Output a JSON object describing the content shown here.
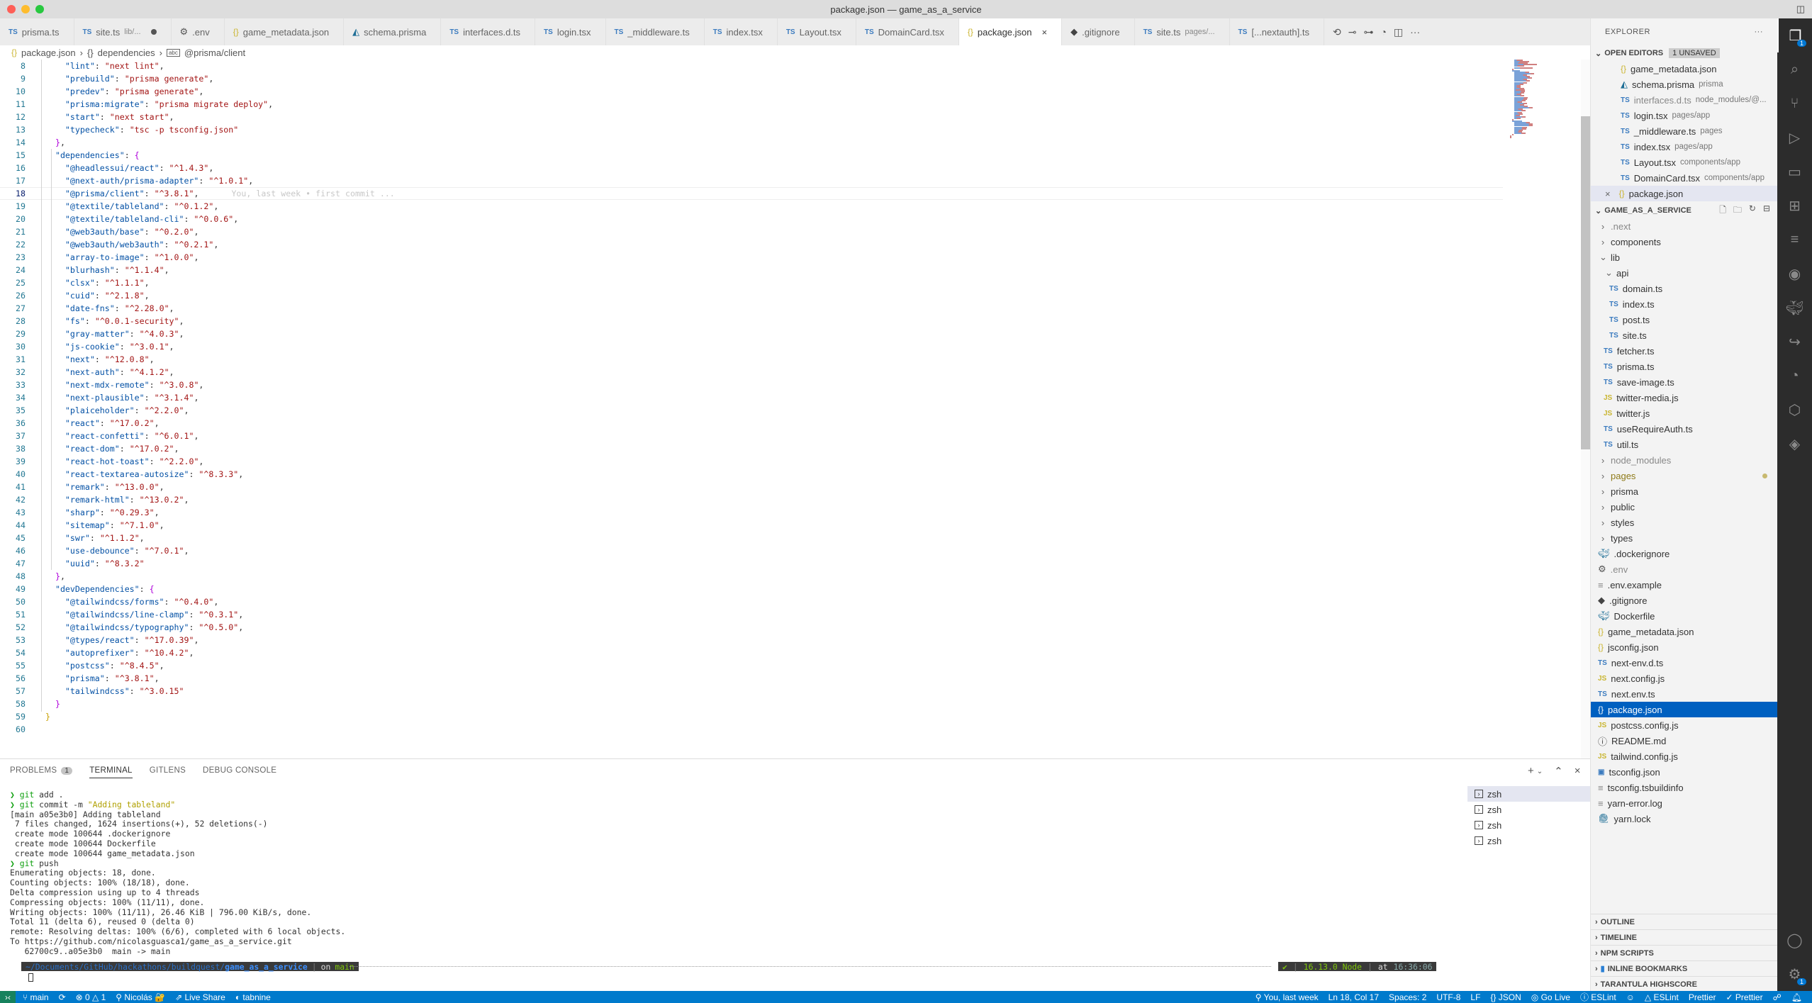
{
  "window": {
    "title": "package.json — game_as_a_service"
  },
  "tabs": [
    {
      "icon": "ts",
      "label": "prisma.ts",
      "desc": ""
    },
    {
      "icon": "ts",
      "label": "site.ts",
      "desc": "lib/...",
      "dirty": true
    },
    {
      "icon": "gear",
      "label": ".env",
      "desc": ""
    },
    {
      "icon": "json",
      "label": "game_metadata.json",
      "desc": ""
    },
    {
      "icon": "prisma",
      "label": "schema.prisma",
      "desc": ""
    },
    {
      "icon": "ts",
      "label": "interfaces.d.ts",
      "desc": ""
    },
    {
      "icon": "ts",
      "label": "login.tsx",
      "desc": ""
    },
    {
      "icon": "ts",
      "label": "_middleware.ts",
      "desc": ""
    },
    {
      "icon": "ts",
      "label": "index.tsx",
      "desc": ""
    },
    {
      "icon": "ts",
      "label": "Layout.tsx",
      "desc": ""
    },
    {
      "icon": "ts",
      "label": "DomainCard.tsx",
      "desc": ""
    },
    {
      "icon": "json",
      "label": "package.json",
      "desc": "",
      "active": true
    },
    {
      "icon": "git",
      "label": ".gitignore",
      "desc": ""
    },
    {
      "icon": "ts",
      "label": "site.ts",
      "desc": "pages/..."
    },
    {
      "icon": "ts",
      "label": "[...nextauth].ts",
      "desc": ""
    }
  ],
  "tab_actions": [
    "git-compare-icon",
    "previous-change-icon",
    "next-change-icon",
    "gitlens-icon",
    "split-editor-icon",
    "more-icon"
  ],
  "breadcrumb": [
    "package.json",
    "dependencies",
    "@prisma/client"
  ],
  "editor": {
    "blame": "You, last week • first commit ...",
    "current_line": 18,
    "lines": [
      {
        "n": 8,
        "indent": 2,
        "key": "lint",
        "val": "next lint",
        "comma": true
      },
      {
        "n": 9,
        "indent": 2,
        "key": "prebuild",
        "val": "prisma generate",
        "comma": true
      },
      {
        "n": 10,
        "indent": 2,
        "key": "predev",
        "val": "prisma generate",
        "comma": true
      },
      {
        "n": 11,
        "indent": 2,
        "key": "prisma:migrate",
        "val": "prisma migrate deploy",
        "comma": true
      },
      {
        "n": 12,
        "indent": 2,
        "key": "start",
        "val": "next start",
        "comma": true
      },
      {
        "n": 13,
        "indent": 2,
        "key": "typecheck",
        "val": "tsc -p tsconfig.json",
        "comma": false
      },
      {
        "n": 14,
        "indent": 1,
        "close": "}",
        "comma": true
      },
      {
        "n": 15,
        "indent": 1,
        "key": "dependencies",
        "open": "{"
      },
      {
        "n": 16,
        "indent": 2,
        "key": "@headlessui/react",
        "val": "^1.4.3",
        "comma": true
      },
      {
        "n": 17,
        "indent": 2,
        "key": "@next-auth/prisma-adapter",
        "val": "^1.0.1",
        "comma": true
      },
      {
        "n": 18,
        "indent": 2,
        "key": "@prisma/client",
        "val": "^3.8.1",
        "comma": true
      },
      {
        "n": 19,
        "indent": 2,
        "key": "@textile/tableland",
        "val": "^0.1.2",
        "comma": true
      },
      {
        "n": 20,
        "indent": 2,
        "key": "@textile/tableland-cli",
        "val": "^0.0.6",
        "comma": true
      },
      {
        "n": 21,
        "indent": 2,
        "key": "@web3auth/base",
        "val": "^0.2.0",
        "comma": true
      },
      {
        "n": 22,
        "indent": 2,
        "key": "@web3auth/web3auth",
        "val": "^0.2.1",
        "comma": true
      },
      {
        "n": 23,
        "indent": 2,
        "key": "array-to-image",
        "val": "^1.0.0",
        "comma": true
      },
      {
        "n": 24,
        "indent": 2,
        "key": "blurhash",
        "val": "^1.1.4",
        "comma": true
      },
      {
        "n": 25,
        "indent": 2,
        "key": "clsx",
        "val": "^1.1.1",
        "comma": true
      },
      {
        "n": 26,
        "indent": 2,
        "key": "cuid",
        "val": "^2.1.8",
        "comma": true
      },
      {
        "n": 27,
        "indent": 2,
        "key": "date-fns",
        "val": "^2.28.0",
        "comma": true
      },
      {
        "n": 28,
        "indent": 2,
        "key": "fs",
        "val": "^0.0.1-security",
        "comma": true
      },
      {
        "n": 29,
        "indent": 2,
        "key": "gray-matter",
        "val": "^4.0.3",
        "comma": true
      },
      {
        "n": 30,
        "indent": 2,
        "key": "js-cookie",
        "val": "^3.0.1",
        "comma": true
      },
      {
        "n": 31,
        "indent": 2,
        "key": "next",
        "val": "^12.0.8",
        "comma": true
      },
      {
        "n": 32,
        "indent": 2,
        "key": "next-auth",
        "val": "^4.1.2",
        "comma": true
      },
      {
        "n": 33,
        "indent": 2,
        "key": "next-mdx-remote",
        "val": "^3.0.8",
        "comma": true
      },
      {
        "n": 34,
        "indent": 2,
        "key": "next-plausible",
        "val": "^3.1.4",
        "comma": true
      },
      {
        "n": 35,
        "indent": 2,
        "key": "plaiceholder",
        "val": "^2.2.0",
        "comma": true
      },
      {
        "n": 36,
        "indent": 2,
        "key": "react",
        "val": "^17.0.2",
        "comma": true
      },
      {
        "n": 37,
        "indent": 2,
        "key": "react-confetti",
        "val": "^6.0.1",
        "comma": true
      },
      {
        "n": 38,
        "indent": 2,
        "key": "react-dom",
        "val": "^17.0.2",
        "comma": true
      },
      {
        "n": 39,
        "indent": 2,
        "key": "react-hot-toast",
        "val": "^2.2.0",
        "comma": true
      },
      {
        "n": 40,
        "indent": 2,
        "key": "react-textarea-autosize",
        "val": "^8.3.3",
        "comma": true
      },
      {
        "n": 41,
        "indent": 2,
        "key": "remark",
        "val": "^13.0.0",
        "comma": true
      },
      {
        "n": 42,
        "indent": 2,
        "key": "remark-html",
        "val": "^13.0.2",
        "comma": true
      },
      {
        "n": 43,
        "indent": 2,
        "key": "sharp",
        "val": "^0.29.3",
        "comma": true
      },
      {
        "n": 44,
        "indent": 2,
        "key": "sitemap",
        "val": "^7.1.0",
        "comma": true
      },
      {
        "n": 45,
        "indent": 2,
        "key": "swr",
        "val": "^1.1.2",
        "comma": true
      },
      {
        "n": 46,
        "indent": 2,
        "key": "use-debounce",
        "val": "^7.0.1",
        "comma": true
      },
      {
        "n": 47,
        "indent": 2,
        "key": "uuid",
        "val": "^8.3.2",
        "comma": false
      },
      {
        "n": 48,
        "indent": 1,
        "close": "}",
        "comma": true
      },
      {
        "n": 49,
        "indent": 1,
        "key": "devDependencies",
        "open": "{"
      },
      {
        "n": 50,
        "indent": 2,
        "key": "@tailwindcss/forms",
        "val": "^0.4.0",
        "comma": true
      },
      {
        "n": 51,
        "indent": 2,
        "key": "@tailwindcss/line-clamp",
        "val": "^0.3.1",
        "comma": true
      },
      {
        "n": 52,
        "indent": 2,
        "key": "@tailwindcss/typography",
        "val": "^0.5.0",
        "comma": true
      },
      {
        "n": 53,
        "indent": 2,
        "key": "@types/react",
        "val": "^17.0.39",
        "comma": true
      },
      {
        "n": 54,
        "indent": 2,
        "key": "autoprefixer",
        "val": "^10.4.2",
        "comma": true
      },
      {
        "n": 55,
        "indent": 2,
        "key": "postcss",
        "val": "^8.4.5",
        "comma": true
      },
      {
        "n": 56,
        "indent": 2,
        "key": "prisma",
        "val": "^3.8.1",
        "comma": true
      },
      {
        "n": 57,
        "indent": 2,
        "key": "tailwindcss",
        "val": "^3.0.15",
        "comma": false
      },
      {
        "n": 58,
        "indent": 1,
        "close": "}",
        "comma": false
      },
      {
        "n": 59,
        "indent": 0,
        "close": "}",
        "comma": false,
        "root": true
      },
      {
        "n": 60,
        "indent": 0,
        "empty": true
      }
    ]
  },
  "panel": {
    "tabs": [
      {
        "label": "PROBLEMS",
        "badge": "1"
      },
      {
        "label": "TERMINAL",
        "active": true
      },
      {
        "label": "GITLENS"
      },
      {
        "label": "DEBUG CONSOLE"
      }
    ],
    "terminal_lines": [
      {
        "type": "cmd",
        "cmd": "git",
        "rest": " add ."
      },
      {
        "type": "cmd",
        "cmd": "git",
        "rest": " commit -m ",
        "str": "\"Adding tableland\""
      },
      {
        "type": "out",
        "text": "[main a05e3b0] Adding tableland"
      },
      {
        "type": "out",
        "text": " 7 files changed, 1624 insertions(+), 52 deletions(-)"
      },
      {
        "type": "out",
        "text": " create mode 100644 .dockerignore"
      },
      {
        "type": "out",
        "text": " create mode 100644 Dockerfile"
      },
      {
        "type": "out",
        "text": " create mode 100644 game_metadata.json"
      },
      {
        "type": "cmd",
        "cmd": "git",
        "rest": " push"
      },
      {
        "type": "out",
        "text": "Enumerating objects: 18, done."
      },
      {
        "type": "out",
        "text": "Counting objects: 100% (18/18), done."
      },
      {
        "type": "out",
        "text": "Delta compression using up to 4 threads"
      },
      {
        "type": "out",
        "text": "Compressing objects: 100% (11/11), done."
      },
      {
        "type": "out",
        "text": "Writing objects: 100% (11/11), 26.46 KiB | 796.00 KiB/s, done."
      },
      {
        "type": "out",
        "text": "Total 11 (delta 6), reused 0 (delta 0)"
      },
      {
        "type": "out",
        "text": "remote: Resolving deltas: 100% (6/6), completed with 6 local objects."
      },
      {
        "type": "out",
        "text": "To https://github.com/nicolasguasca1/game_as_a_service.git"
      },
      {
        "type": "out",
        "text": "   62700c9..a05e3b0  main -> main"
      }
    ],
    "prompt": {
      "path_prefix": "~/Documents/GitHub/hackathons/buildquest/",
      "path_dir": "game_as_a_service",
      "on": "on",
      "branch": "main",
      "check": "✔",
      "node": "16.13.0 Node",
      "at": "at",
      "time": "16:36:06"
    },
    "terminals": [
      "zsh",
      "zsh",
      "zsh",
      "zsh"
    ]
  },
  "explorer": {
    "title": "EXPLORER",
    "open_editors_label": "OPEN EDITORS",
    "unsaved_label": "1 UNSAVED",
    "open_editors": [
      {
        "icon": "json",
        "name": "game_metadata.json",
        "desc": ""
      },
      {
        "icon": "prisma",
        "name": "schema.prisma",
        "desc": "prisma"
      },
      {
        "icon": "ts",
        "name": "interfaces.d.ts",
        "desc": "node_modules/@...",
        "muted": true
      },
      {
        "icon": "ts",
        "name": "login.tsx",
        "desc": "pages/app"
      },
      {
        "icon": "ts",
        "name": "_middleware.ts",
        "desc": "pages"
      },
      {
        "icon": "ts",
        "name": "index.tsx",
        "desc": "pages/app"
      },
      {
        "icon": "ts",
        "name": "Layout.tsx",
        "desc": "components/app"
      },
      {
        "icon": "ts",
        "name": "DomainCard.tsx",
        "desc": "components/app"
      },
      {
        "icon": "json",
        "name": "package.json",
        "desc": "",
        "selected": true
      }
    ],
    "project_label": "GAME_AS_A_SERVICE",
    "tree": [
      {
        "depth": 0,
        "type": "folder",
        "open": false,
        "name": ".next",
        "muted": true
      },
      {
        "depth": 0,
        "type": "folder",
        "open": false,
        "name": "components"
      },
      {
        "depth": 0,
        "type": "folder",
        "open": true,
        "name": "lib"
      },
      {
        "depth": 1,
        "type": "folder",
        "open": true,
        "name": "api"
      },
      {
        "depth": 2,
        "type": "file",
        "icon": "ts",
        "name": "domain.ts"
      },
      {
        "depth": 2,
        "type": "file",
        "icon": "ts",
        "name": "index.ts"
      },
      {
        "depth": 2,
        "type": "file",
        "icon": "ts",
        "name": "post.ts"
      },
      {
        "depth": 2,
        "type": "file",
        "icon": "ts",
        "name": "site.ts"
      },
      {
        "depth": 1,
        "type": "file",
        "icon": "ts",
        "name": "fetcher.ts"
      },
      {
        "depth": 1,
        "type": "file",
        "icon": "ts",
        "name": "prisma.ts"
      },
      {
        "depth": 1,
        "type": "file",
        "icon": "ts",
        "name": "save-image.ts"
      },
      {
        "depth": 1,
        "type": "file",
        "icon": "js",
        "name": "twitter-media.js"
      },
      {
        "depth": 1,
        "type": "file",
        "icon": "js",
        "name": "twitter.js"
      },
      {
        "depth": 1,
        "type": "file",
        "icon": "ts",
        "name": "useRequireAuth.ts"
      },
      {
        "depth": 1,
        "type": "file",
        "icon": "ts",
        "name": "util.ts"
      },
      {
        "depth": 0,
        "type": "folder",
        "open": false,
        "name": "node_modules",
        "muted": true
      },
      {
        "depth": 0,
        "type": "folder",
        "open": false,
        "name": "pages",
        "modified": true
      },
      {
        "depth": 0,
        "type": "folder",
        "open": false,
        "name": "prisma"
      },
      {
        "depth": 0,
        "type": "folder",
        "open": false,
        "name": "public"
      },
      {
        "depth": 0,
        "type": "folder",
        "open": false,
        "name": "styles"
      },
      {
        "depth": 0,
        "type": "folder",
        "open": false,
        "name": "types"
      },
      {
        "depth": 0,
        "type": "file",
        "icon": "docker",
        "name": ".dockerignore"
      },
      {
        "depth": 0,
        "type": "file",
        "icon": "gear",
        "name": ".env",
        "muted": true
      },
      {
        "depth": 0,
        "type": "file",
        "icon": "text",
        "name": ".env.example"
      },
      {
        "depth": 0,
        "type": "file",
        "icon": "git",
        "name": ".gitignore"
      },
      {
        "depth": 0,
        "type": "file",
        "icon": "docker",
        "name": "Dockerfile"
      },
      {
        "depth": 0,
        "type": "file",
        "icon": "json",
        "name": "game_metadata.json"
      },
      {
        "depth": 0,
        "type": "file",
        "icon": "json",
        "name": "jsconfig.json"
      },
      {
        "depth": 0,
        "type": "file",
        "icon": "ts",
        "name": "next-env.d.ts"
      },
      {
        "depth": 0,
        "type": "file",
        "icon": "js",
        "name": "next.config.js"
      },
      {
        "depth": 0,
        "type": "file",
        "icon": "ts",
        "name": "next.env.ts"
      },
      {
        "depth": 0,
        "type": "file",
        "icon": "json",
        "name": "package.json",
        "selected": true
      },
      {
        "depth": 0,
        "type": "file",
        "icon": "js",
        "name": "postcss.config.js"
      },
      {
        "depth": 0,
        "type": "file",
        "icon": "info",
        "name": "README.md"
      },
      {
        "depth": 0,
        "type": "file",
        "icon": "js",
        "name": "tailwind.config.js"
      },
      {
        "depth": 0,
        "type": "file",
        "icon": "tsconfig",
        "name": "tsconfig.json"
      },
      {
        "depth": 0,
        "type": "file",
        "icon": "text",
        "name": "tsconfig.tsbuildinfo"
      },
      {
        "depth": 0,
        "type": "file",
        "icon": "text",
        "name": "yarn-error.log"
      },
      {
        "depth": 0,
        "type": "file",
        "icon": "yarn",
        "name": "yarn.lock"
      }
    ],
    "bottom_sections": [
      "OUTLINE",
      "TIMELINE",
      "NPM SCRIPTS",
      "INLINE BOOKMARKS",
      "TARANTULA HIGHSCORE"
    ]
  },
  "activity_bar": {
    "explorer_badge": "1",
    "settings_badge": "1"
  },
  "status_bar": {
    "branch": "main",
    "errors": "0",
    "warnings": "1",
    "user": "Nicolás",
    "live_share": "Live Share",
    "tabnine": "tabnine",
    "blame": "You, last week",
    "position": "Ln 18, Col 17",
    "spaces": "Spaces: 2",
    "encoding": "UTF-8",
    "eol": "LF",
    "language": "JSON",
    "go_live": "Go Live",
    "eslint1": "ESLint",
    "eslint2": "ESLint",
    "prettier1": "Prettier",
    "prettier2": "Prettier"
  },
  "colors": {
    "accent": "#007acc",
    "remote": "#16825d",
    "selection": "#0060c0",
    "key": "#0451a5",
    "string": "#a31515"
  }
}
